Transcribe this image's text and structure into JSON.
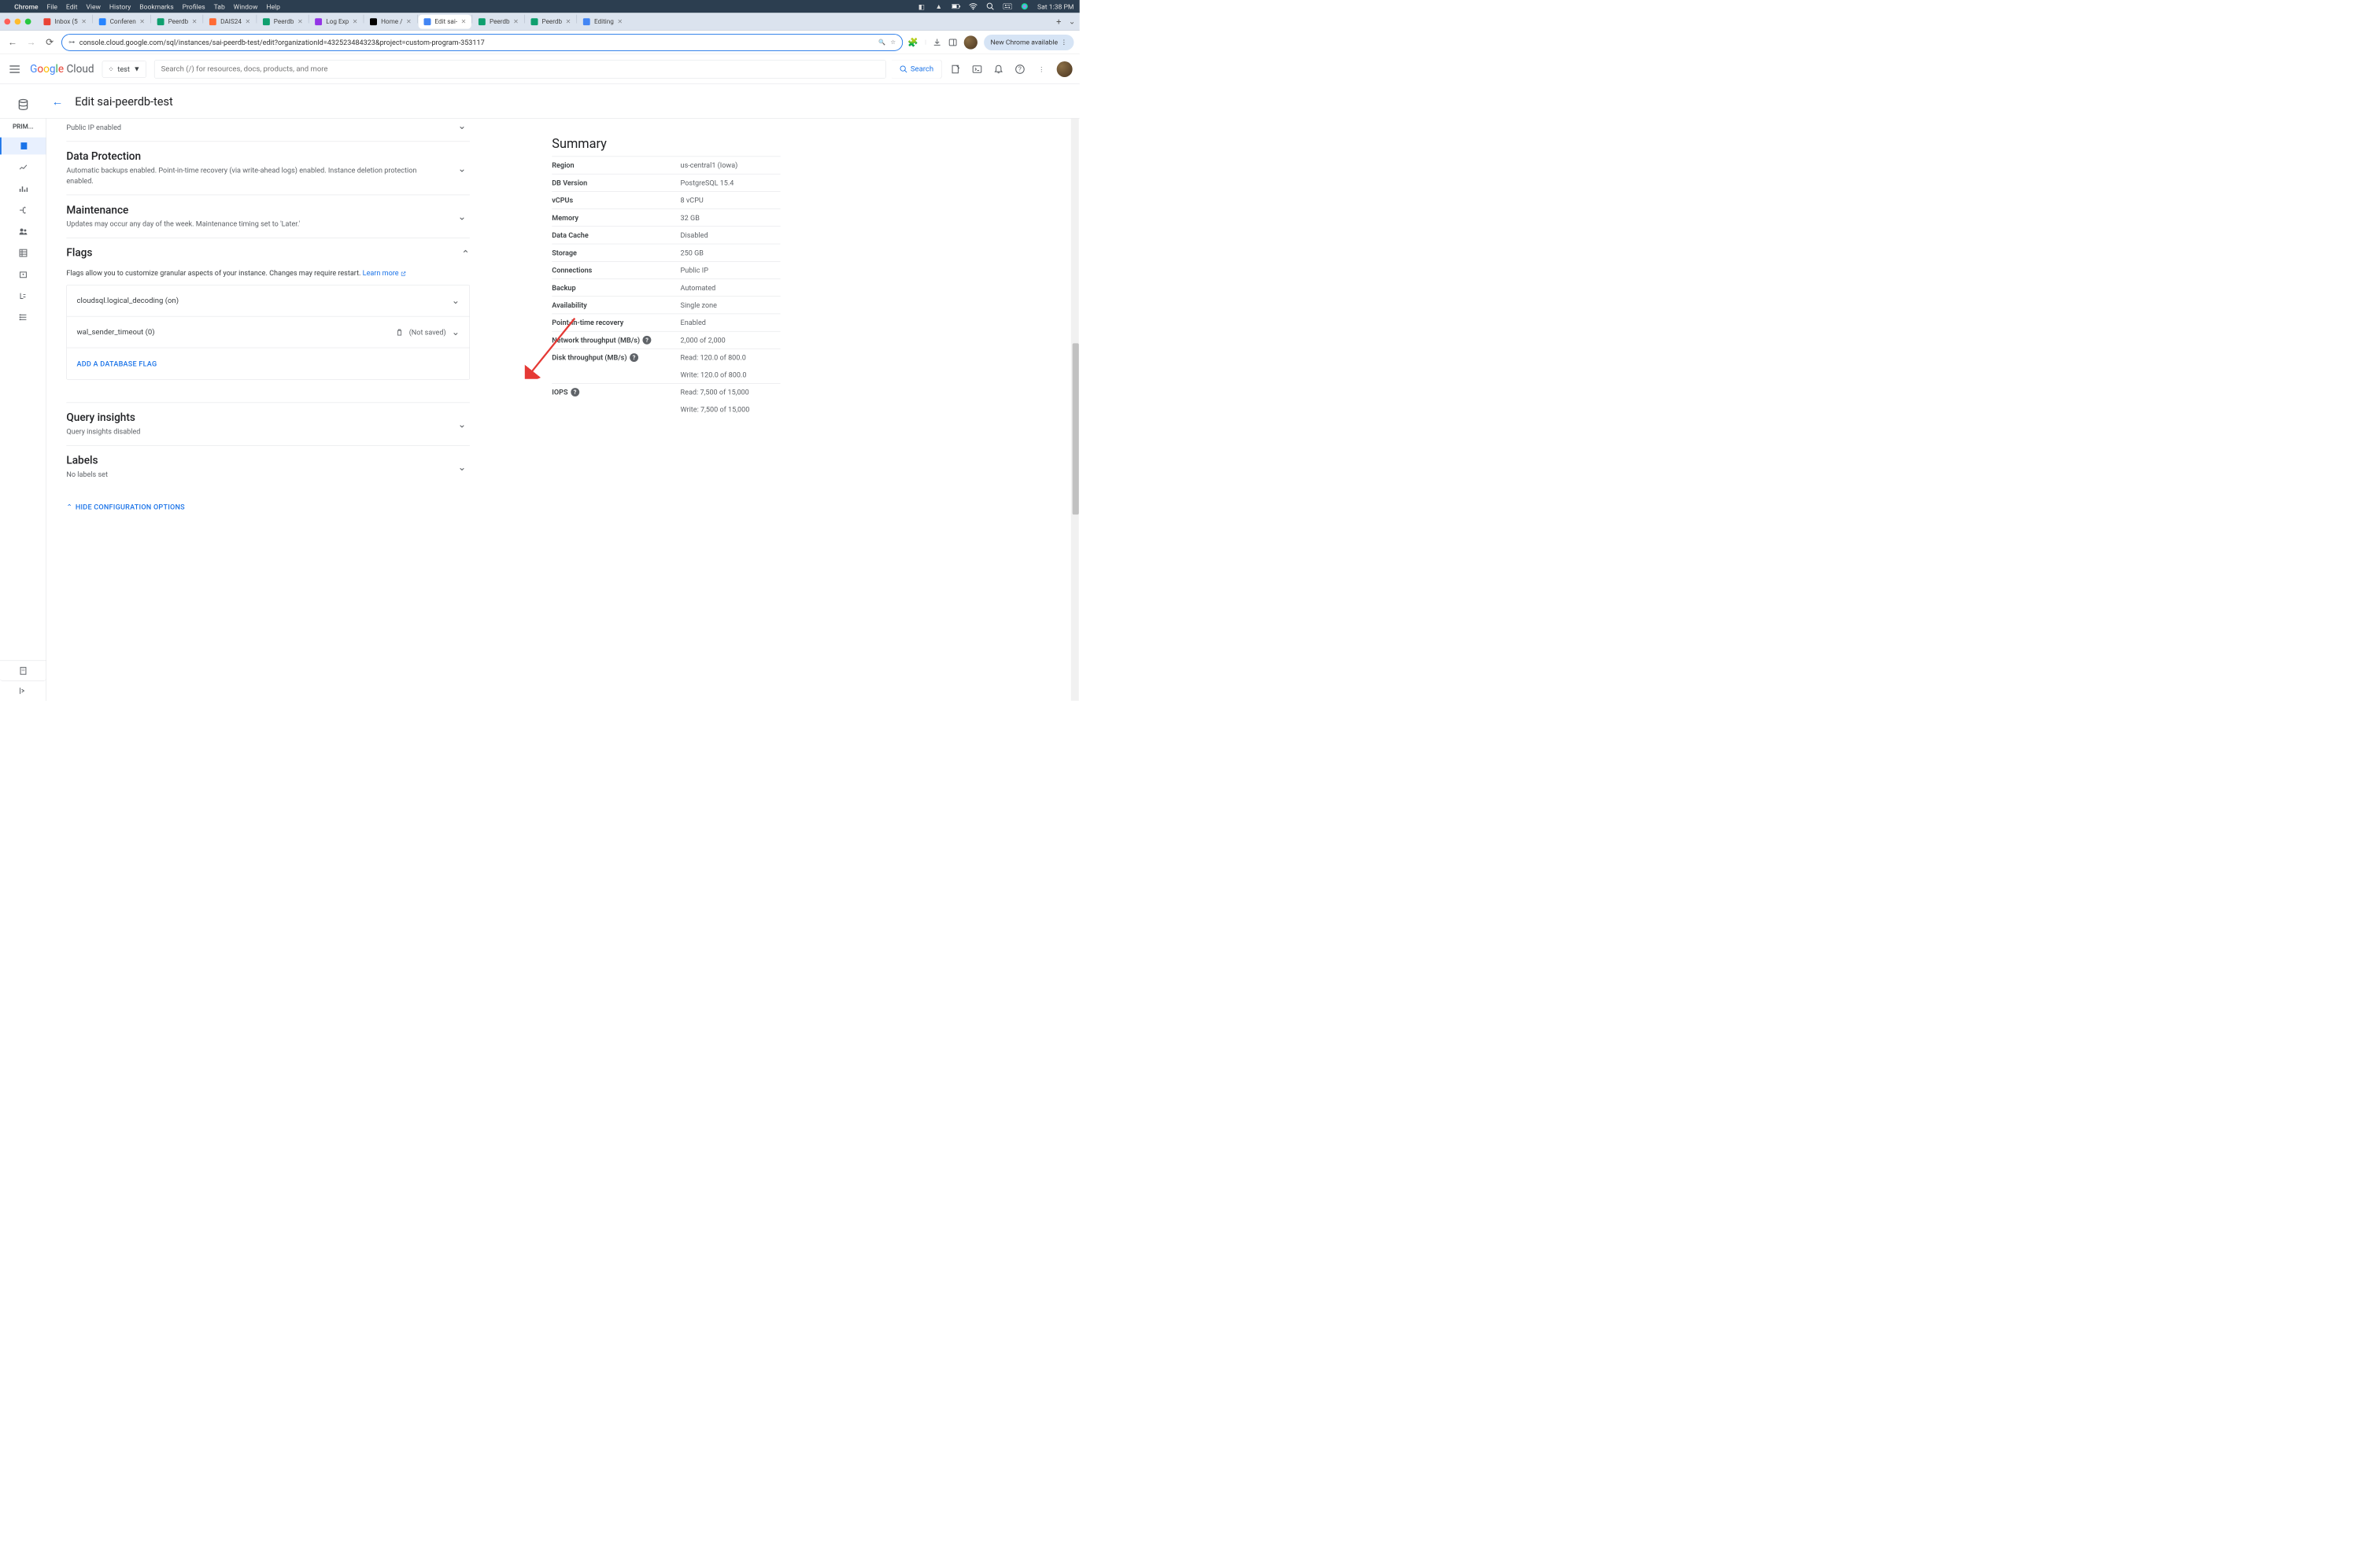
{
  "macos": {
    "app": "Chrome",
    "menus": [
      "File",
      "Edit",
      "View",
      "History",
      "Bookmarks",
      "Profiles",
      "Tab",
      "Window",
      "Help"
    ],
    "clock": "Sat 1:38 PM"
  },
  "tabs": [
    {
      "label": "Inbox (5",
      "icon": "gmail"
    },
    {
      "label": "Conferen",
      "icon": "confluence"
    },
    {
      "label": "Peerdb",
      "icon": "peerdb"
    },
    {
      "label": "DAIS24",
      "icon": "dais"
    },
    {
      "label": "Peerdb",
      "icon": "peerdb"
    },
    {
      "label": "Log Exp",
      "icon": "gcp-logs"
    },
    {
      "label": "Home /",
      "icon": "x"
    },
    {
      "label": "Edit sai-",
      "icon": "gcp-sql",
      "active": true
    },
    {
      "label": "Peerdb",
      "icon": "peerdb"
    },
    {
      "label": "Peerdb",
      "icon": "peerdb"
    },
    {
      "label": "Editing",
      "icon": "shortcut"
    }
  ],
  "toolbar": {
    "url": "console.cloud.google.com/sql/instances/sai-peerdb-test/edit?organizationId=432523484323&project=custom-program-353117",
    "update_label": "New Chrome available"
  },
  "gcp": {
    "logo": "Google Cloud",
    "project": "test",
    "search_placeholder": "Search (/) for resources, docs, products, and more",
    "search_btn": "Search"
  },
  "page": {
    "title": "Edit sai-peerdb-test",
    "side_primary": "PRIM..."
  },
  "sections": {
    "networking_sub": "Public IP enabled",
    "dataprot_head": "Data Protection",
    "dataprot_sub": "Automatic backups enabled. Point-in-time recovery (via write-ahead logs) enabled. Instance deletion protection enabled.",
    "maint_head": "Maintenance",
    "maint_sub": "Updates may occur any day of the week. Maintenance timing set to 'Later.'",
    "flags_head": "Flags",
    "flags_desc1": "Flags allow you to customize granular aspects of your instance. Changes may require restart. ",
    "learn_more": "Learn more",
    "flags": [
      {
        "name": "cloudsql.logical_decoding (on)"
      },
      {
        "name": "wal_sender_timeout (0)",
        "not_saved": "(Not saved)"
      }
    ],
    "add_flag": "ADD A DATABASE FLAG",
    "query_head": "Query insights",
    "query_sub": "Query insights disabled",
    "labels_head": "Labels",
    "labels_sub": "No labels set",
    "hide_config": "HIDE CONFIGURATION OPTIONS"
  },
  "summary": {
    "title": "Summary",
    "rows": [
      {
        "k": "Region",
        "v": "us-central1 (Iowa)"
      },
      {
        "k": "DB Version",
        "v": "PostgreSQL 15.4"
      },
      {
        "k": "vCPUs",
        "v": "8 vCPU"
      },
      {
        "k": "Memory",
        "v": "32 GB"
      },
      {
        "k": "Data Cache",
        "v": "Disabled"
      },
      {
        "k": "Storage",
        "v": "250 GB"
      },
      {
        "k": "Connections",
        "v": "Public IP"
      },
      {
        "k": "Backup",
        "v": "Automated"
      },
      {
        "k": "Availability",
        "v": "Single zone"
      },
      {
        "k": "Point-in-time recovery",
        "v": "Enabled"
      },
      {
        "k": "Network throughput (MB/s)",
        "v": "2,000 of 2,000",
        "help": true
      },
      {
        "k": "Disk throughput (MB/s)",
        "v": "Read: 120.0 of 800.0",
        "v2": "Write: 120.0 of 800.0",
        "help": true
      },
      {
        "k": "IOPS",
        "v": "Read: 7,500 of 15,000",
        "v2": "Write: 7,500 of 15,000",
        "help": true
      }
    ]
  }
}
